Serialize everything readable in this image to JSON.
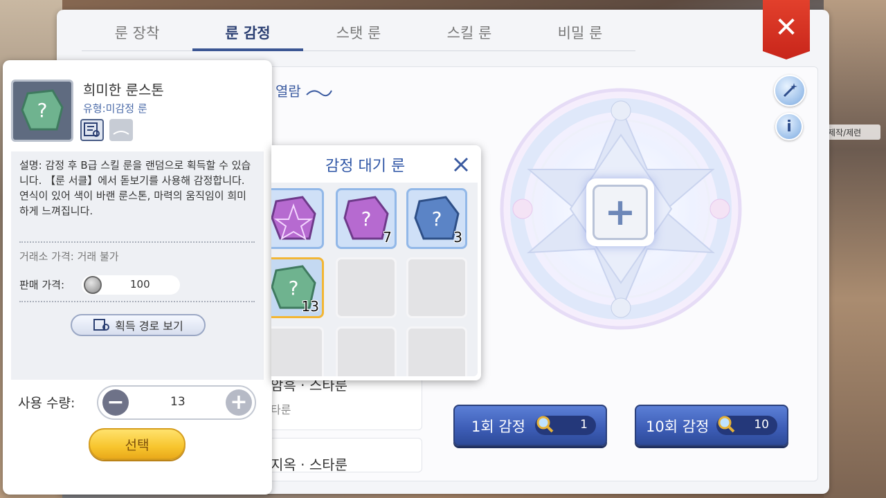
{
  "tabs": [
    {
      "label": "룬 장착"
    },
    {
      "label": "룬 감정"
    },
    {
      "label": "스탯 룬"
    },
    {
      "label": "스킬 룬"
    },
    {
      "label": "비밀 룬"
    }
  ],
  "background": {
    "side_label": "제작/제련"
  },
  "header": {
    "text": "열람"
  },
  "list": [
    {
      "title": "암흑 · 스타룬",
      "subtitle": "타룬"
    },
    {
      "title": "지옥 · 스타룬"
    }
  ],
  "item": {
    "name": "희미한 룬스톤",
    "type": "유형:미감정 룬",
    "description": "설명: 감정 후 B급 스킬 룬을 랜덤으로 획득할 수 있습니다. 【룬 서클】에서 돋보기를 사용해 감정합니다. 연식이 있어 색이 바랜 룬스톤, 마력의 움직임이 희미하게 느껴집니다.",
    "trade_price": "거래소 가격: 거래 불가",
    "sell_label": "판매 가격:",
    "sell_price": "100",
    "route_button": "획득 경로 보기",
    "qty_label": "사용 수량:",
    "qty_value": "13",
    "select_button": "선택"
  },
  "popup": {
    "title": "감정 대기 룬",
    "slots": [
      {
        "state": "filled",
        "rune": "purple-pentagram-rune",
        "count": ""
      },
      {
        "state": "filled",
        "rune": "purple-unknown-rune",
        "count": "7"
      },
      {
        "state": "filled",
        "rune": "blue-unknown-rune",
        "count": "3"
      },
      {
        "state": "selected",
        "rune": "green-unknown-rune",
        "count": "13"
      },
      {
        "state": "empty"
      },
      {
        "state": "empty"
      },
      {
        "state": "empty"
      },
      {
        "state": "empty"
      },
      {
        "state": "empty"
      }
    ]
  },
  "appraise": {
    "once": {
      "label": "1회 감정",
      "cost": "1"
    },
    "ten": {
      "label": "10회 감정",
      "cost": "10"
    }
  },
  "colors": {
    "accent": "#3b5693",
    "button_blue": "#3c5cb5",
    "close_red": "#d32f22",
    "select_gold": "#f7c52e"
  }
}
